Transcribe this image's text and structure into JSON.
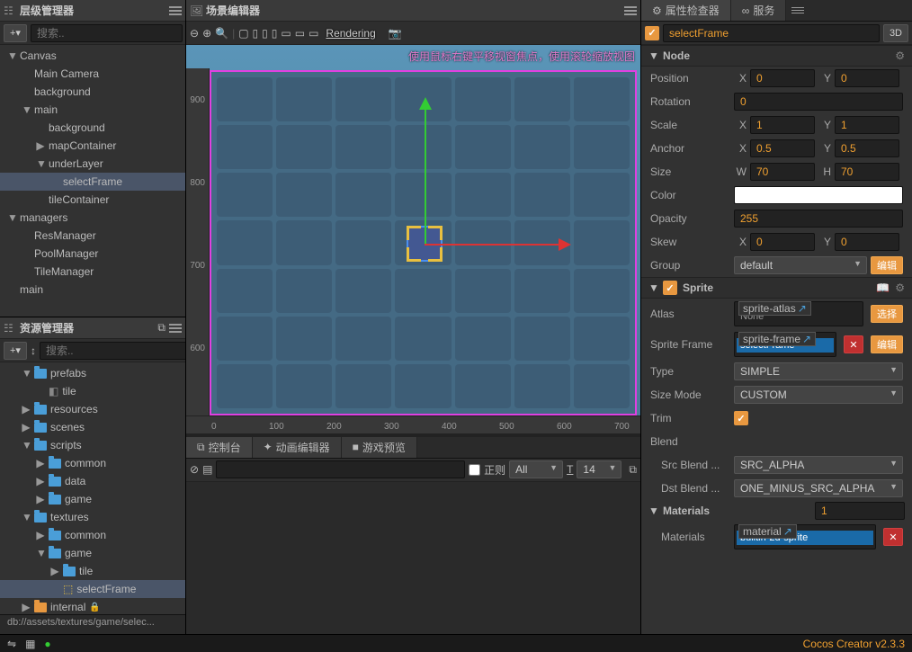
{
  "panels": {
    "hierarchy": "层级管理器",
    "assets": "资源管理器",
    "scene": "场景编辑器",
    "inspector": "属性检查器",
    "services": "服务",
    "console": "控制台",
    "anim": "动画编辑器",
    "preview": "游戏预览"
  },
  "search": {
    "placeholder": "搜索.."
  },
  "hierarchy": {
    "items": [
      {
        "l": "Canvas",
        "d": 0,
        "exp": true
      },
      {
        "l": "Main Camera",
        "d": 1
      },
      {
        "l": "background",
        "d": 1
      },
      {
        "l": "main",
        "d": 1,
        "exp": true
      },
      {
        "l": "background",
        "d": 2
      },
      {
        "l": "mapContainer",
        "d": 2,
        "col": true
      },
      {
        "l": "underLayer",
        "d": 2,
        "exp": true
      },
      {
        "l": "selectFrame",
        "d": 3,
        "sel": true
      },
      {
        "l": "tileContainer",
        "d": 2
      },
      {
        "l": "managers",
        "d": 0,
        "exp": true
      },
      {
        "l": "ResManager",
        "d": 1
      },
      {
        "l": "PoolManager",
        "d": 1
      },
      {
        "l": "TileManager",
        "d": 1
      },
      {
        "l": "main",
        "d": 0
      }
    ]
  },
  "assets": {
    "items": [
      {
        "l": "prefabs",
        "d": 1,
        "exp": true,
        "f": "b"
      },
      {
        "l": "tile",
        "d": 2,
        "ico": "pf"
      },
      {
        "l": "resources",
        "d": 1,
        "col": true,
        "f": "b"
      },
      {
        "l": "scenes",
        "d": 1,
        "col": true,
        "f": "b"
      },
      {
        "l": "scripts",
        "d": 1,
        "exp": true,
        "f": "b"
      },
      {
        "l": "common",
        "d": 2,
        "col": true,
        "f": "b"
      },
      {
        "l": "data",
        "d": 2,
        "col": true,
        "f": "b"
      },
      {
        "l": "game",
        "d": 2,
        "col": true,
        "f": "b"
      },
      {
        "l": "textures",
        "d": 1,
        "exp": true,
        "f": "b"
      },
      {
        "l": "common",
        "d": 2,
        "col": true,
        "f": "b"
      },
      {
        "l": "game",
        "d": 2,
        "exp": true,
        "f": "b"
      },
      {
        "l": "tile",
        "d": 3,
        "col": true,
        "f": "b"
      },
      {
        "l": "selectFrame",
        "d": 3,
        "sel": true,
        "ico": "sf"
      },
      {
        "l": "internal",
        "d": 1,
        "col": true,
        "f": "o",
        "lock": true
      }
    ],
    "path": "db://assets/textures/game/selec..."
  },
  "scene": {
    "rendering": "Rendering",
    "hint": "使用鼠标右键平移视窗焦点，使用滚轮缩放视图",
    "vticks": [
      "900",
      "800",
      "700",
      "600"
    ],
    "hticks": [
      "0",
      "100",
      "200",
      "300",
      "400",
      "500",
      "600",
      "700"
    ]
  },
  "inspector": {
    "threeD": "3D",
    "nodeName": "selectFrame",
    "node_title": "Node",
    "sprite_title": "Sprite",
    "pos": {
      "x": "0",
      "y": "0"
    },
    "rot": "0",
    "scale": {
      "x": "1",
      "y": "1"
    },
    "anchor": {
      "x": "0.5",
      "y": "0.5"
    },
    "size": {
      "w": "70",
      "h": "70"
    },
    "opacity": "255",
    "skew": {
      "x": "0",
      "y": "0"
    },
    "group": "default",
    "editBtn": "编辑",
    "selectBtn": "选择",
    "atlas": {
      "tag": "sprite-atlas",
      "val": "None"
    },
    "spriteFrame": {
      "tag": "sprite-frame",
      "val": "selectFrame"
    },
    "type": "SIMPLE",
    "sizeMode": "CUSTOM",
    "srcBlend": "SRC_ALPHA",
    "dstBlend": "ONE_MINUS_SRC_ALPHA",
    "materials_count": "1",
    "materials": {
      "tag": "material",
      "val": "builtin-2d-sprite"
    },
    "labels": {
      "position": "Position",
      "rotation": "Rotation",
      "scale": "Scale",
      "anchor": "Anchor",
      "size": "Size",
      "color": "Color",
      "opacity": "Opacity",
      "skew": "Skew",
      "group": "Group",
      "atlas": "Atlas",
      "spriteFrame": "Sprite Frame",
      "type": "Type",
      "sizeMode": "Size Mode",
      "trim": "Trim",
      "blend": "Blend",
      "srcBlend": "Src Blend ...",
      "dstBlend": "Dst Blend ...",
      "materials": "Materials"
    }
  },
  "console": {
    "regex": "正则",
    "filter": "All",
    "font": "14"
  },
  "footer": {
    "version": "Cocos Creator v2.3.3"
  }
}
